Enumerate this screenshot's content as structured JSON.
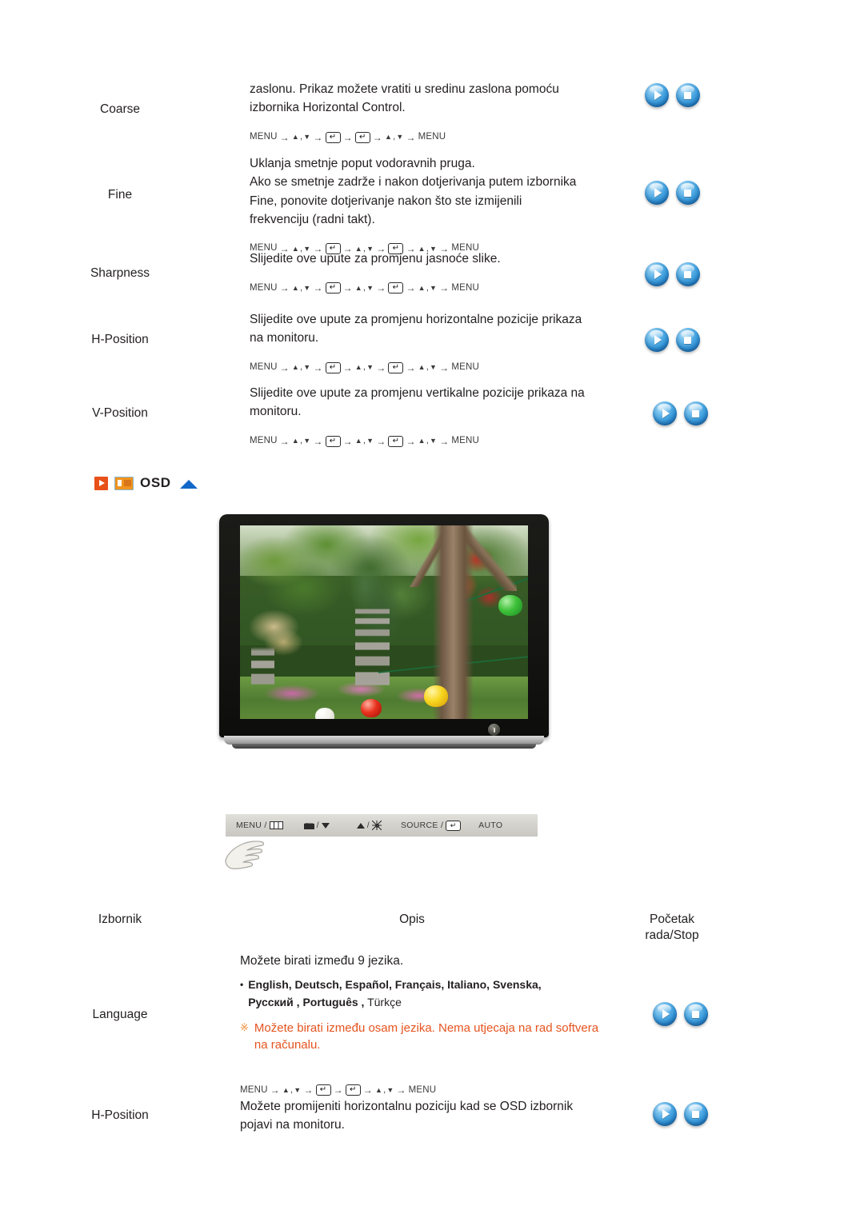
{
  "nav_path_icons": {
    "menu": "MENU",
    "arrow": "→",
    "up": "▲",
    "down": "▼",
    "comma": ",",
    "enter": "↵"
  },
  "top_rows": [
    {
      "menu": "Coarse",
      "desc": "zaslonu. Prikaz možete vratiti u sredinu zaslona pomoću izbornika Horizontal Control.",
      "path_kind": "short"
    },
    {
      "menu": "Fine",
      "desc": "Uklanja smetnje poput vodoravnih pruga.\nAko se smetnje zadrže i nakon dotjerivanja putem izbornika Fine, ponovite dotjerivanje nakon što ste izmijenili frekvenciju (radni takt).",
      "path_kind": "long"
    },
    {
      "menu": "Sharpness",
      "desc": "Slijedite ove upute za promjenu jasnoće slike.",
      "path_kind": "long"
    },
    {
      "menu": "H-Position",
      "desc": "Slijedite ove upute za promjenu horizontalne pozicije prikaza na monitoru.",
      "path_kind": "long"
    },
    {
      "menu": "V-Position",
      "desc": "Slijedite ove upute za promjenu vertikalne pozicije prikaza na monitoru.",
      "path_kind": "long"
    }
  ],
  "osd_section": {
    "label": "OSD",
    "accent_orange": "#e8501a",
    "accent_screen": "#f0941f",
    "accent_blue": "#1268c8"
  },
  "monitor": {
    "alt": "LCD monitor displaying a garden photograph with stone pagodas and paper lanterns"
  },
  "control_bar": {
    "items": [
      {
        "label": "MENU /",
        "icon": "menu-box-icon"
      },
      {
        "label": "/",
        "icon": "contrast-icon",
        "icon2": "triangle-down-icon"
      },
      {
        "label": "/",
        "icon": "triangle-up-icon",
        "icon2": "brightness-sun-icon"
      },
      {
        "label": "SOURCE /",
        "icon": "enter-key-icon"
      },
      {
        "label": "AUTO",
        "icon": ""
      }
    ],
    "labels": {
      "menu": "MENU /",
      "slash": "/",
      "source": "SOURCE /",
      "auto": "AUTO"
    }
  },
  "table_headers": {
    "menu": "Izbornik",
    "desc": "Opis",
    "start_stop_line1": "Početak",
    "start_stop_line2": "rada/Stop"
  },
  "bottom_rows": [
    {
      "menu": "Language",
      "desc_intro": "Možete birati između 9 jezika.",
      "lang_bullet": "•",
      "lang_line1": "English, Deutsch, Español, Français,  Italiano, Svenska,",
      "lang_line2_bold": "Русский , Português ,",
      "lang_line2_normal": " Türkçe",
      "warn_mark": "※",
      "warn_text": "Možete birati između osam jezika. Nema utjecaja na rad softvera na računalu.",
      "warn_color": "#e5541f",
      "path_kind": "short"
    },
    {
      "menu": "H-Position",
      "desc": "Možete promijeniti horizontalnu poziciju kad se OSD izbornik pojavi na monitoru.",
      "path_kind": "none"
    }
  ],
  "buttons": {
    "play_label": "play",
    "stop_label": "stop"
  }
}
